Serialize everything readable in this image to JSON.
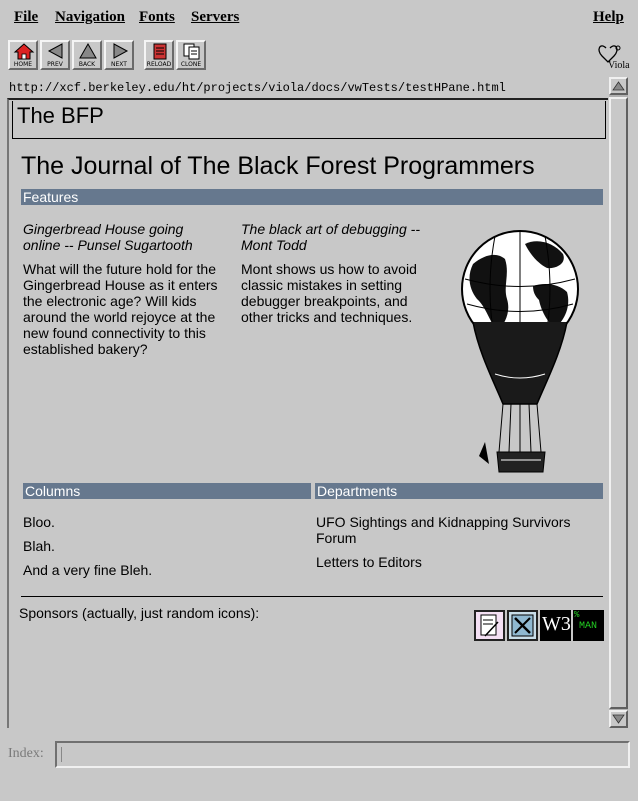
{
  "menubar": {
    "file": "File",
    "navigation": "Navigation",
    "fonts": "Fonts",
    "servers": "Servers",
    "help": "Help"
  },
  "toolbar": {
    "home": "HOME",
    "prev": "PREV",
    "back": "BACK",
    "next": "NEXT",
    "reload": "RELOAD",
    "clone": "CLONE"
  },
  "logo_icon": "viola-globe-icon",
  "logo_text": "Viola",
  "address": {
    "url": "http://xcf.berkeley.edu/ht/projects/viola/docs/vwTests/testHPane.html"
  },
  "document": {
    "title": "The BFP",
    "heading": "The Journal of The Black Forest Programmers",
    "features": {
      "header": "Features",
      "article1_title": "Gingerbread House going online -- Punsel Sugartooth",
      "article1_body": "What will the future hold for the Gingerbread House as it enters the electronic age? Will kids around the world rejoyce at the new  found connectivity to this established bakery?",
      "article2_title": "The black art of debugging -- Mont Todd",
      "article2_body": "Mont shows us how to avoid classic mistakes in setting debugger breakpoints, and other tricks and techniques.",
      "image_icon": "hot-air-balloon-globe-icon"
    },
    "columns": {
      "header": "Columns",
      "items": [
        "Bloo.",
        "Blah.",
        "And a very fine Bleh."
      ]
    },
    "departments": {
      "header": "Departments",
      "items": [
        "UFO Sightings and Kidnapping Survivors Forum",
        "Letters to Editors"
      ]
    },
    "sponsors": {
      "label": "Sponsors (actually, just random icons):",
      "icons": [
        "doc-icon",
        "x-window-icon",
        "w3-icon",
        "xman-icon"
      ],
      "w3_text": "W3",
      "xman_text": "MAN"
    }
  },
  "index": {
    "label": "Index:",
    "value": ""
  },
  "colors": {
    "background": "#c8c8c8",
    "section_header": "#66788e",
    "section_header_text": "#ffffff"
  }
}
